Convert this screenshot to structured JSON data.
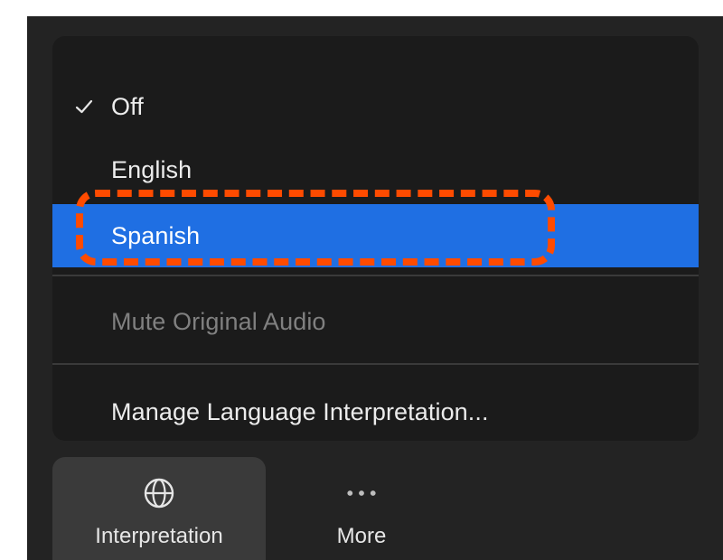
{
  "menu": {
    "items": [
      {
        "label": "Off",
        "checked": true
      },
      {
        "label": "English"
      },
      {
        "label": "Spanish",
        "highlighted": true
      },
      {
        "label": "Mute Original Audio",
        "disabled": true
      },
      {
        "label": "Manage Language Interpretation..."
      }
    ],
    "colors": {
      "selected_bg": "#1f6fe3",
      "highlight_outline": "#ff4b00"
    }
  },
  "toolbar": {
    "interpretation": {
      "label": "Interpretation",
      "icon": "globe-icon"
    },
    "more": {
      "label": "More",
      "icon": "ellipsis-icon"
    }
  }
}
